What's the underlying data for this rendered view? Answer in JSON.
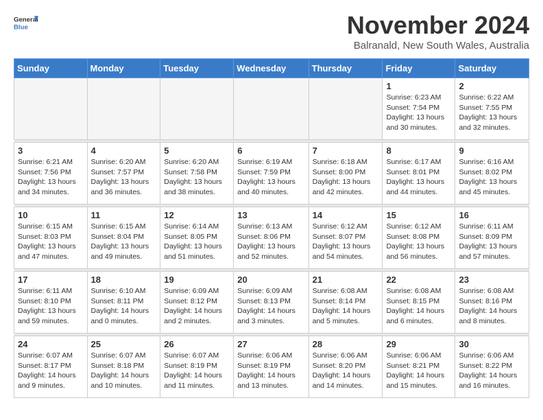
{
  "logo": {
    "line1": "General",
    "line2": "Blue"
  },
  "title": "November 2024",
  "subtitle": "Balranald, New South Wales, Australia",
  "weekdays": [
    "Sunday",
    "Monday",
    "Tuesday",
    "Wednesday",
    "Thursday",
    "Friday",
    "Saturday"
  ],
  "weeks": [
    [
      {
        "day": "",
        "empty": true
      },
      {
        "day": "",
        "empty": true
      },
      {
        "day": "",
        "empty": true
      },
      {
        "day": "",
        "empty": true
      },
      {
        "day": "",
        "empty": true
      },
      {
        "day": "1",
        "rise": "6:23 AM",
        "set": "7:54 PM",
        "daylight": "13 hours and 30 minutes."
      },
      {
        "day": "2",
        "rise": "6:22 AM",
        "set": "7:55 PM",
        "daylight": "13 hours and 32 minutes."
      }
    ],
    [
      {
        "day": "3",
        "rise": "6:21 AM",
        "set": "7:56 PM",
        "daylight": "13 hours and 34 minutes."
      },
      {
        "day": "4",
        "rise": "6:20 AM",
        "set": "7:57 PM",
        "daylight": "13 hours and 36 minutes."
      },
      {
        "day": "5",
        "rise": "6:20 AM",
        "set": "7:58 PM",
        "daylight": "13 hours and 38 minutes."
      },
      {
        "day": "6",
        "rise": "6:19 AM",
        "set": "7:59 PM",
        "daylight": "13 hours and 40 minutes."
      },
      {
        "day": "7",
        "rise": "6:18 AM",
        "set": "8:00 PM",
        "daylight": "13 hours and 42 minutes."
      },
      {
        "day": "8",
        "rise": "6:17 AM",
        "set": "8:01 PM",
        "daylight": "13 hours and 44 minutes."
      },
      {
        "day": "9",
        "rise": "6:16 AM",
        "set": "8:02 PM",
        "daylight": "13 hours and 45 minutes."
      }
    ],
    [
      {
        "day": "10",
        "rise": "6:15 AM",
        "set": "8:03 PM",
        "daylight": "13 hours and 47 minutes."
      },
      {
        "day": "11",
        "rise": "6:15 AM",
        "set": "8:04 PM",
        "daylight": "13 hours and 49 minutes."
      },
      {
        "day": "12",
        "rise": "6:14 AM",
        "set": "8:05 PM",
        "daylight": "13 hours and 51 minutes."
      },
      {
        "day": "13",
        "rise": "6:13 AM",
        "set": "8:06 PM",
        "daylight": "13 hours and 52 minutes."
      },
      {
        "day": "14",
        "rise": "6:12 AM",
        "set": "8:07 PM",
        "daylight": "13 hours and 54 minutes."
      },
      {
        "day": "15",
        "rise": "6:12 AM",
        "set": "8:08 PM",
        "daylight": "13 hours and 56 minutes."
      },
      {
        "day": "16",
        "rise": "6:11 AM",
        "set": "8:09 PM",
        "daylight": "13 hours and 57 minutes."
      }
    ],
    [
      {
        "day": "17",
        "rise": "6:11 AM",
        "set": "8:10 PM",
        "daylight": "13 hours and 59 minutes."
      },
      {
        "day": "18",
        "rise": "6:10 AM",
        "set": "8:11 PM",
        "daylight": "14 hours and 0 minutes."
      },
      {
        "day": "19",
        "rise": "6:09 AM",
        "set": "8:12 PM",
        "daylight": "14 hours and 2 minutes."
      },
      {
        "day": "20",
        "rise": "6:09 AM",
        "set": "8:13 PM",
        "daylight": "14 hours and 3 minutes."
      },
      {
        "day": "21",
        "rise": "6:08 AM",
        "set": "8:14 PM",
        "daylight": "14 hours and 5 minutes."
      },
      {
        "day": "22",
        "rise": "6:08 AM",
        "set": "8:15 PM",
        "daylight": "14 hours and 6 minutes."
      },
      {
        "day": "23",
        "rise": "6:08 AM",
        "set": "8:16 PM",
        "daylight": "14 hours and 8 minutes."
      }
    ],
    [
      {
        "day": "24",
        "rise": "6:07 AM",
        "set": "8:17 PM",
        "daylight": "14 hours and 9 minutes."
      },
      {
        "day": "25",
        "rise": "6:07 AM",
        "set": "8:18 PM",
        "daylight": "14 hours and 10 minutes."
      },
      {
        "day": "26",
        "rise": "6:07 AM",
        "set": "8:19 PM",
        "daylight": "14 hours and 11 minutes."
      },
      {
        "day": "27",
        "rise": "6:06 AM",
        "set": "8:19 PM",
        "daylight": "14 hours and 13 minutes."
      },
      {
        "day": "28",
        "rise": "6:06 AM",
        "set": "8:20 PM",
        "daylight": "14 hours and 14 minutes."
      },
      {
        "day": "29",
        "rise": "6:06 AM",
        "set": "8:21 PM",
        "daylight": "14 hours and 15 minutes."
      },
      {
        "day": "30",
        "rise": "6:06 AM",
        "set": "8:22 PM",
        "daylight": "14 hours and 16 minutes."
      }
    ]
  ]
}
